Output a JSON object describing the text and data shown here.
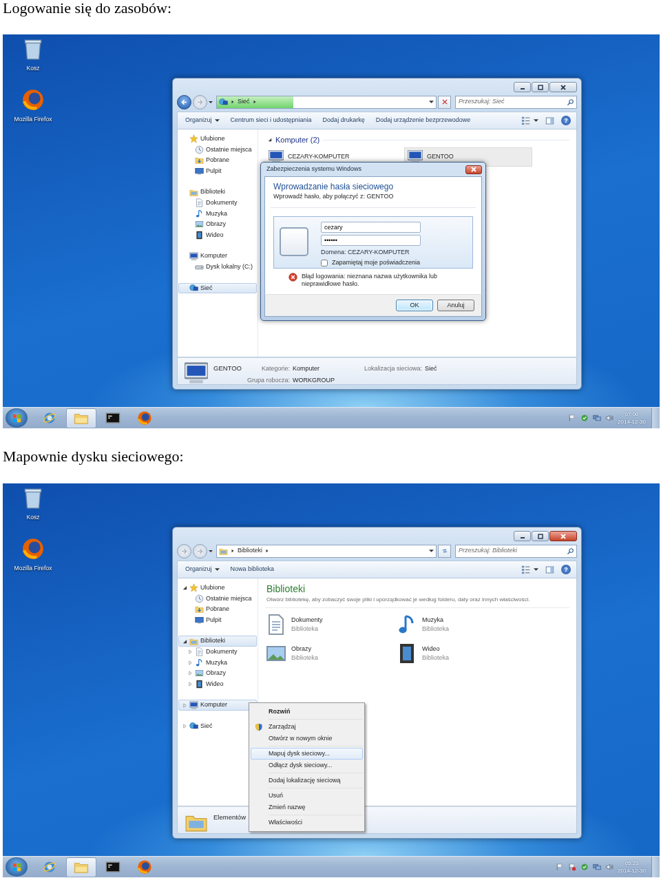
{
  "sections": [
    {
      "heading": "Logowanie się do zasobów:",
      "desktop_icons": [
        {
          "kind": "recycle-bin",
          "label": "Kosz"
        },
        {
          "kind": "firefox",
          "label": "Mozilla Firefox"
        }
      ],
      "window": {
        "close_highlighted": false,
        "back_enabled": true,
        "address": {
          "kind": "network",
          "crumbs": [
            "Sieć"
          ],
          "level": 0.35
        },
        "address_button": {
          "kind": "stop"
        },
        "search_placeholder": "Przeszukaj: Sieć",
        "commands": [
          {
            "label": "Organizuj",
            "dropdown": true
          },
          {
            "label": "Centrum sieci i udostępniania",
            "dropdown": false
          },
          {
            "label": "Dodaj drukarkę",
            "dropdown": false
          },
          {
            "label": "Dodaj urządzenie bezprzewodowe",
            "dropdown": false
          }
        ],
        "help": "?",
        "sidebar": [
          {
            "label": "Ulubione",
            "kind": "star",
            "selected": false,
            "children": [
              {
                "label": "Ostatnie miejsca",
                "kind": "recent",
                "selected": false
              },
              {
                "label": "Pobrane",
                "kind": "download",
                "selected": false
              },
              {
                "label": "Pulpit",
                "kind": "desktop",
                "selected": false
              }
            ]
          },
          {
            "label": "Biblioteki",
            "kind": "library",
            "selected": false,
            "children": [
              {
                "label": "Dokumenty",
                "kind": "documents",
                "selected": false
              },
              {
                "label": "Muzyka",
                "kind": "music",
                "selected": false
              },
              {
                "label": "Obrazy",
                "kind": "pictures",
                "selected": false
              },
              {
                "label": "Wideo",
                "kind": "video",
                "selected": false
              }
            ]
          },
          {
            "label": "Komputer",
            "kind": "computer",
            "selected": false,
            "children": [
              {
                "label": "Dysk lokalny (C:)",
                "kind": "drive",
                "selected": false
              }
            ]
          },
          {
            "label": "Sieć",
            "kind": "network",
            "selected": true
          }
        ],
        "content": {
          "kind": "network",
          "group": "Komputer (2)",
          "group_expanded": true,
          "items": [
            {
              "label": "CEZARY-KOMPUTER",
              "selected": false
            },
            {
              "label": "GENTOO",
              "selected": true
            }
          ]
        },
        "details": {
          "kind": "computer",
          "name": "GENTOO",
          "fields": [
            {
              "label": "Kategorie:",
              "value": "Komputer"
            },
            {
              "label": "Lokalizacja sieciowa:",
              "value": "Sieć"
            },
            {
              "label": "Grupa robocza:",
              "value": "WORKGROUP"
            }
          ]
        },
        "dialog": {
          "title": "Zabezpieczenia systemu Windows",
          "heading": "Wprowadzanie hasła sieciowego",
          "prompt": "Wprowadź hasło, aby połączyć z: GENTOO",
          "username": "cezary",
          "password": "••••••",
          "domain": "Domena: CEZARY-KOMPUTER",
          "remember": {
            "label": "Zapamiętaj moje poświadczenia",
            "checked": false
          },
          "error": "Błąd logowania: nieznana nazwa użytkownika lub nieprawidłowe hasło.",
          "buttons": [
            {
              "label": "OK",
              "default": true
            },
            {
              "label": "Anuluj",
              "default": false
            }
          ]
        }
      },
      "taskbar": {
        "apps": [
          {
            "kind": "ie",
            "selected": false
          },
          {
            "kind": "explorer",
            "selected": true
          },
          {
            "kind": "cmd",
            "selected": false
          },
          {
            "kind": "firefox",
            "selected": false
          }
        ],
        "tray": [
          {
            "kind": "flag"
          },
          {
            "kind": "update"
          },
          {
            "kind": "network-tray"
          },
          {
            "kind": "volume"
          }
        ],
        "time": "07:00",
        "date": "2014-12-30"
      }
    },
    {
      "heading": "Mapownie dysku sieciowego:",
      "desktop_icons": [
        {
          "kind": "recycle-bin",
          "label": "Kosz"
        },
        {
          "kind": "firefox",
          "label": "Mozilla Firefox"
        }
      ],
      "window": {
        "close_highlighted": true,
        "back_enabled": false,
        "address": {
          "kind": "library",
          "crumbs": [
            "Biblioteki"
          ]
        },
        "address_button": {
          "kind": "refresh"
        },
        "search_placeholder": "Przeszukaj: Biblioteki",
        "commands": [
          {
            "label": "Organizuj",
            "dropdown": true
          },
          {
            "label": "Nowa biblioteka",
            "dropdown": false
          }
        ],
        "help": "?",
        "sidebar": [
          {
            "label": "Ulubione",
            "kind": "star",
            "selected": false,
            "expanded": true,
            "children": [
              {
                "label": "Ostatnie miejsca",
                "kind": "recent",
                "selected": false
              },
              {
                "label": "Pobrane",
                "kind": "download",
                "selected": false
              },
              {
                "label": "Pulpit",
                "kind": "desktop",
                "selected": false
              }
            ]
          },
          {
            "label": "Biblioteki",
            "kind": "library",
            "selected": true,
            "expanded": true,
            "children": [
              {
                "label": "Dokumenty",
                "kind": "documents",
                "selected": false,
                "expanded": false
              },
              {
                "label": "Muzyka",
                "kind": "music",
                "selected": false,
                "expanded": false
              },
              {
                "label": "Obrazy",
                "kind": "pictures",
                "selected": false,
                "expanded": false
              },
              {
                "label": "Wideo",
                "kind": "video",
                "selected": false,
                "expanded": false
              }
            ]
          },
          {
            "label": "Komputer",
            "kind": "computer",
            "selected": true,
            "expanded": false
          },
          {
            "label": "Sieć",
            "kind": "network",
            "selected": false,
            "expanded": false
          }
        ],
        "content": {
          "kind": "libraries",
          "title": "Biblioteki",
          "subtitle": "Otwórz bibliotekę, aby zobaczyć swoje pliki i uporządkować je według folderu, daty oraz innych właściwości.",
          "items": [
            {
              "label": "Dokumenty",
              "sublabel": "Biblioteka",
              "kind": "documents"
            },
            {
              "label": "Muzyka",
              "sublabel": "Biblioteka",
              "kind": "music"
            },
            {
              "label": "Obrazy",
              "sublabel": "Biblioteka",
              "kind": "pictures"
            },
            {
              "label": "Wideo",
              "sublabel": "Biblioteka",
              "kind": "video"
            }
          ]
        },
        "details": {
          "kind": "library",
          "name": "Elementów"
        },
        "context_menu": {
          "sections": [
            [
              {
                "label": "Rozwiń",
                "kind": "plain",
                "bold": true,
                "selected": false
              }
            ],
            [
              {
                "label": "Zarządzaj",
                "kind": "shield",
                "bold": false,
                "selected": false
              },
              {
                "label": "Otwórz w nowym oknie",
                "kind": "plain",
                "bold": false,
                "selected": false
              }
            ],
            [
              {
                "label": "Mapuj dysk sieciowy...",
                "kind": "plain",
                "bold": false,
                "selected": true
              },
              {
                "label": "Odłącz dysk sieciowy...",
                "kind": "plain",
                "bold": false,
                "selected": false
              }
            ],
            [
              {
                "label": "Dodaj lokalizację sieciową",
                "kind": "plain",
                "bold": false,
                "selected": false
              }
            ],
            [
              {
                "label": "Usuń",
                "kind": "plain",
                "bold": false,
                "selected": false
              },
              {
                "label": "Zmień nazwę",
                "kind": "plain",
                "bold": false,
                "selected": false
              }
            ],
            [
              {
                "label": "Właściwości",
                "kind": "plain",
                "bold": false,
                "selected": false
              }
            ]
          ]
        }
      },
      "taskbar": {
        "apps": [
          {
            "kind": "ie",
            "selected": false
          },
          {
            "kind": "explorer",
            "selected": true
          },
          {
            "kind": "cmd",
            "selected": false
          },
          {
            "kind": "firefox",
            "selected": false
          }
        ],
        "tray": [
          {
            "kind": "flag"
          },
          {
            "kind": "flag-alert"
          },
          {
            "kind": "update"
          },
          {
            "kind": "network-tray"
          },
          {
            "kind": "volume"
          }
        ],
        "time": "05:23",
        "date": "2014-12-30"
      }
    }
  ]
}
